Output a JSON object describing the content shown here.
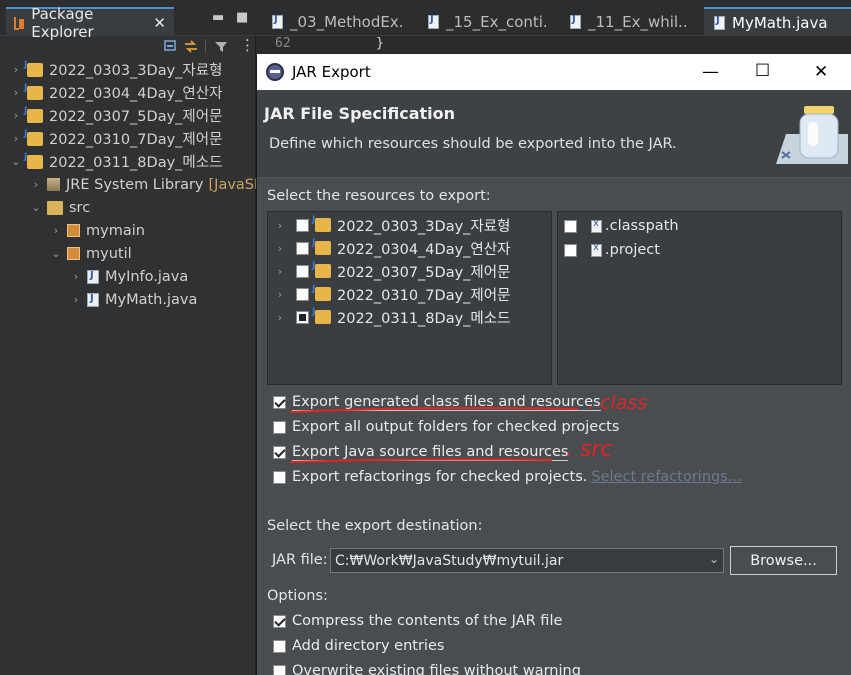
{
  "package_explorer": {
    "tab_title": "Package Explorer",
    "tab_close": "✕",
    "tree": [
      {
        "label": "2022_0303_3Day_자료형",
        "chev": "›"
      },
      {
        "label": "2022_0304_4Day_연산자",
        "chev": "›"
      },
      {
        "label": "2022_0307_5Day_제어문",
        "chev": "›"
      },
      {
        "label": "2022_0310_7Day_제어문",
        "chev": "›"
      },
      {
        "label": "2022_0311_8Day_메소드",
        "chev": "⌄"
      },
      {
        "label": "JRE System Library",
        "extra": "[JavaSE-",
        "chev": "›"
      },
      {
        "label": "src",
        "chev": "⌄"
      },
      {
        "label": "mymain",
        "chev": "›"
      },
      {
        "label": "myutil",
        "chev": "⌄"
      },
      {
        "label": "MyInfo.java",
        "chev": "›"
      },
      {
        "label": "MyMath.java",
        "chev": "›"
      }
    ]
  },
  "editor": {
    "tabs": [
      {
        "label": "_03_MethodEx..."
      },
      {
        "label": "_15_Ex_conti..."
      },
      {
        "label": "_11_Ex_whil..."
      },
      {
        "label": "MyMath.java"
      }
    ],
    "line_number": "62",
    "line_code": "}"
  },
  "dialog": {
    "title": "JAR Export",
    "heading": "JAR File Specification",
    "description": "Define which resources should be exported into the JAR.",
    "resources_label": "Select the resources to export:",
    "projects": [
      {
        "label": "2022_0303_3Day_자료형",
        "state": "unchecked"
      },
      {
        "label": "2022_0304_4Day_연산자",
        "state": "unchecked"
      },
      {
        "label": "2022_0307_5Day_제어문",
        "state": "unchecked"
      },
      {
        "label": "2022_0310_7Day_제어문",
        "state": "unchecked"
      },
      {
        "label": "2022_0311_8Day_메소드",
        "state": "partial"
      }
    ],
    "files": [
      {
        "label": ".classpath",
        "state": "unchecked"
      },
      {
        "label": ".project",
        "state": "unchecked"
      }
    ],
    "export_options": [
      {
        "label": "Export generated class files and resources",
        "checked": true
      },
      {
        "label": "Export all output folders for checked projects",
        "checked": false
      },
      {
        "label": "Export Java source files and resources",
        "checked": true
      },
      {
        "label": "Export refactorings for checked projects.",
        "checked": false,
        "link": "Select refactorings..."
      }
    ],
    "destination_label": "Select the export destination:",
    "jar_file_label": "JAR file:",
    "jar_file_value": "C:₩Work₩JavaStudy₩mytuil.jar",
    "browse_label": "Browse...",
    "options_label": "Options:",
    "options": [
      {
        "label": "Compress the contents of the JAR file",
        "checked": true
      },
      {
        "label": "Add directory entries",
        "checked": false
      },
      {
        "label": "Overwrite existing files without warning",
        "checked": false
      }
    ]
  },
  "annotations": [
    {
      "text": ". class"
    },
    {
      "text": ". src"
    }
  ]
}
